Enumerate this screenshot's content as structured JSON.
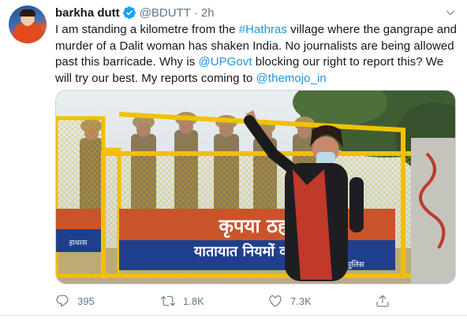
{
  "tweet": {
    "author_name": "barkha dutt",
    "handle": "@BDUTT",
    "separator": "·",
    "timestamp": "2h",
    "text_parts": [
      "I am standing a kilometre from the ",
      "#Hathras",
      " village where the gangrape and murder of a Dalit woman has shaken India. No journalists are being allowed past this barricade. Why is ",
      "@UPGovt",
      " blocking our right to report this? We will try our best. My reports coming to ",
      "@themojo_in"
    ],
    "media": {
      "sign_line1": "कृपया ठहर",
      "sign_line2": "यातायात नियमों का पाल",
      "sign_line3": "आज्ञा से - पुलिस",
      "sign_side": "हाथरस"
    },
    "actions": {
      "reply_count": "395",
      "retweet_count": "1.8K",
      "like_count": "7.3K"
    }
  },
  "colors": {
    "link": "#1b95e0",
    "secondary_text": "#657786",
    "verified": "#1da1f2",
    "barricade": "#f2c200"
  },
  "icons": [
    "verified-badge-icon",
    "chevron-down-icon",
    "reply-icon",
    "retweet-icon",
    "like-icon",
    "share-icon"
  ]
}
